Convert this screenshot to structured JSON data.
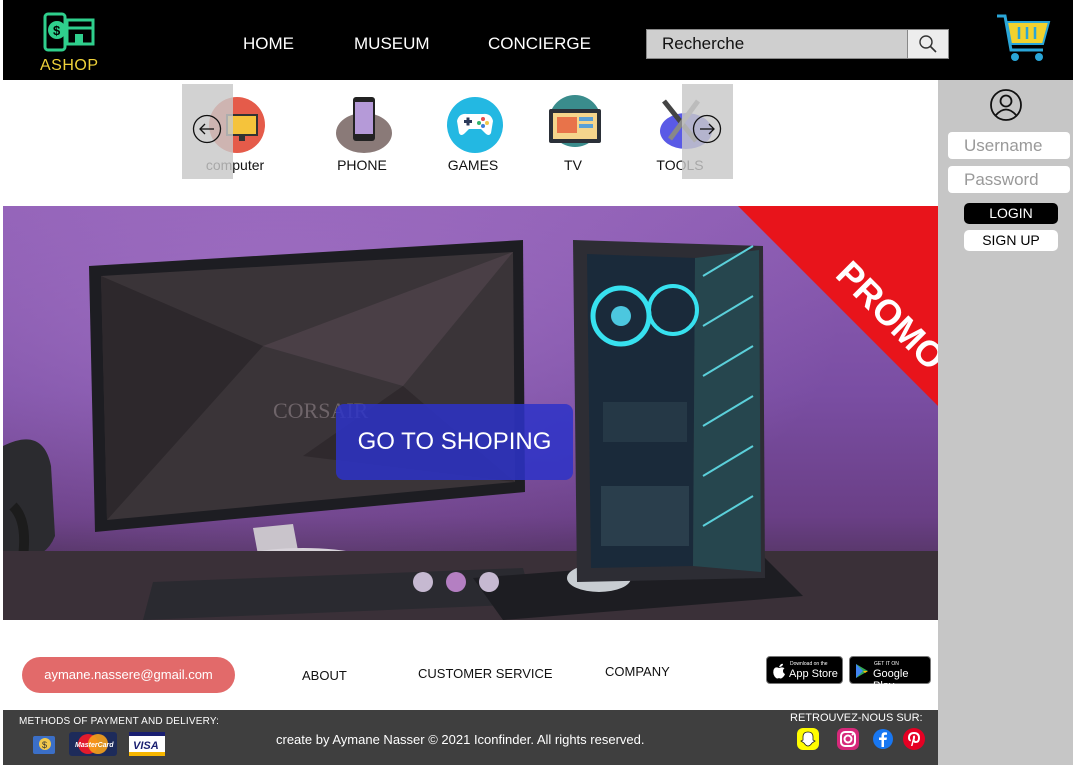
{
  "header": {
    "logo_text": "ASHOP",
    "nav": [
      "HOME",
      "MUSEUM",
      "CONCIERGE"
    ],
    "search_placeholder": "Recherche"
  },
  "sidebar": {
    "username_placeholder": "Username",
    "password_placeholder": "Password",
    "login_label": "LOGIN",
    "signup_label": "SIGN UP"
  },
  "categories": [
    {
      "label": "computer",
      "icon": "computer-icon"
    },
    {
      "label": "PHONE",
      "icon": "phone-icon"
    },
    {
      "label": "GAMES",
      "icon": "gamepad-icon"
    },
    {
      "label": "TV",
      "icon": "tv-icon"
    },
    {
      "label": "TOOLS",
      "icon": "tools-icon"
    }
  ],
  "hero": {
    "promo_text": "PROMO",
    "brand_text": "CORSAIR",
    "cta_label": "GO TO SHOPING",
    "slide_dots": 3
  },
  "footer": {
    "email": "aymane.nassere@gmail.com",
    "links": [
      "ABOUT",
      "CUSTOMER SERVICE",
      "COMPANY"
    ],
    "app_store": {
      "small": "Download on the",
      "big": "App Store"
    },
    "google_play": {
      "small": "GET IT ON",
      "big": "Google Play"
    },
    "payment_title": "METHODS OF PAYMENT AND DELIVERY:",
    "payment_methods": [
      "delivery",
      "MasterCard",
      "VISA"
    ],
    "copyright": "create by Aymane Nasser © 2021 Iconfinder. All rights reserved.",
    "follow_title": "RETROUVEZ-NOUS SUR:",
    "social": [
      "snapchat-icon",
      "instagram-icon",
      "facebook-icon",
      "pinterest-icon"
    ]
  },
  "colors": {
    "header_bg": "#000000",
    "sidebar_bg": "#c6c6c6",
    "promo_red": "#e8141b",
    "cta_blue": "#2d32c8",
    "email_pill": "#e26a6a",
    "footer_bg": "#3f3f3f"
  }
}
